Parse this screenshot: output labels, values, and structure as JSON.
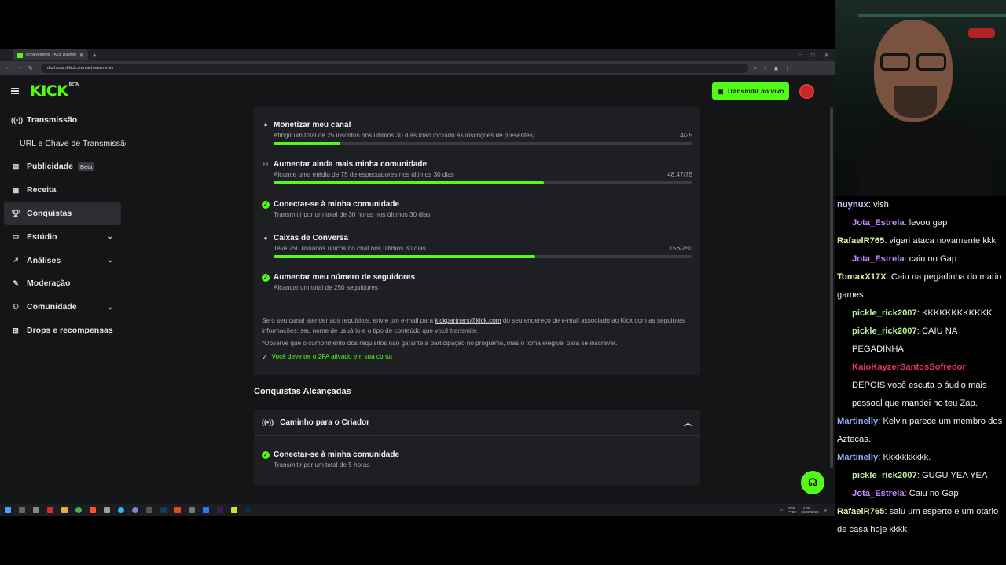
{
  "browser": {
    "tab_title": "Achievements - Kick Dashboard",
    "url": "dashboard.kick.com/achievements",
    "new_tab": "+"
  },
  "topnav": {
    "logo": "KICK",
    "logo_badge": "BETA",
    "live_button": "Transmitir ao vivo"
  },
  "sidebar": {
    "items": [
      {
        "label": "Transmissão",
        "icon": "broadcast-icon"
      },
      {
        "label": "URL e Chave de Transmissão",
        "icon": ""
      },
      {
        "label": "Publicidade",
        "icon": "ad-icon",
        "badge": "Beta"
      },
      {
        "label": "Receita",
        "icon": "revenue-icon"
      },
      {
        "label": "Conquistas",
        "icon": "trophy-icon"
      },
      {
        "label": "Estúdio",
        "icon": "studio-icon"
      },
      {
        "label": "Análises",
        "icon": "analytics-icon"
      },
      {
        "label": "Moderação",
        "icon": "moderation-icon"
      },
      {
        "label": "Comunidade",
        "icon": "community-icon"
      },
      {
        "label": "Drops e recompensas",
        "icon": "drops-icon"
      }
    ]
  },
  "requirements": [
    {
      "title": "Monetizar meu canal",
      "desc": "Atingir um total de 25 inscritos nos últimos 30 dias (não incluido as inscrições de presentes)",
      "progress_text": "4/25",
      "progress": 0.16
    },
    {
      "title": "Aumentar ainda mais minha comunidade",
      "desc": "Alcance uma média de 75 de espectadores nos últimos 30 dias",
      "progress_text": "48.47/75",
      "progress": 0.646
    },
    {
      "title": "Conectar-se à minha comunidade",
      "desc": "Transmitir por um total de 30 horas nos últimos 30 dias",
      "progress_text": "",
      "progress": null
    },
    {
      "title": "Caixas de Conversa",
      "desc": "Teve 250 usuários únicos no chat nos últimos 30 dias",
      "progress_text": "156/250",
      "progress": 0.624
    },
    {
      "title": "Aumentar meu número de seguidores",
      "desc": "Alcançar um total de 250 seguidores",
      "progress_text": "",
      "progress": null
    }
  ],
  "info": {
    "p1_a": "Se o seu canal atender aos requisitos, envie um e-mail para ",
    "p1_link": "kickpartners@kick.com",
    "p1_b": " do seu endereço de e-mail associado ao Kick com as seguintes informações: seu nome de usuário e o tipo de conteúdo que você transmite.",
    "p2": "*Observe que o cumprimento dos requisitos não garante a participação no programa, mas o torna elegível para se inscrever.",
    "check": "Você deve ter o 2FA ativado em sua conta"
  },
  "achieved": {
    "section_title": "Conquistas Alcançadas",
    "group_title": "Caminho para o Criador",
    "item_title": "Conectar-se à minha comunidade",
    "item_desc": "Transmitir por um total de 5 horas"
  },
  "taskbar": {
    "lang": "POR",
    "lang2": "PTB2",
    "time": "14:48",
    "date": "02/08/2026"
  },
  "chat": [
    {
      "user": "nuynux",
      "color": "#c9c4ff",
      "text": "vish",
      "indent": false
    },
    {
      "user": "Jota_Estrela",
      "color": "#c48cff",
      "text": "levou gap",
      "indent": true
    },
    {
      "user": "RafaelR765",
      "color": "#d8f5a2",
      "text": "vigari ataca novamente kkk",
      "indent": false
    },
    {
      "user": "Jota_Estrela",
      "color": "#c48cff",
      "text": "caiu no Gap",
      "indent": true
    },
    {
      "user": "TomaxX17X",
      "color": "#d8f5a2",
      "text": "Caiu na pegadinha do mario games",
      "indent": false
    },
    {
      "user": "pickle_rick2007",
      "color": "#b6f09c",
      "text": "KKKKKKKKKKKK",
      "indent": true
    },
    {
      "user": "pickle_rick2007",
      "color": "#b6f09c",
      "text": "CAIU NA PEGADINHA",
      "indent": true
    },
    {
      "user": "KaioKayzerSantosSofredor",
      "color": "#e8355a",
      "text": "DEPOIS você escuta o áudio mais pessoal que mandei no teu Zap.",
      "indent": true
    },
    {
      "user": "Martinelly",
      "color": "#8ab4f8",
      "text": "Kelvin parece um membro dos Aztecas.",
      "indent": false
    },
    {
      "user": "Martinelly",
      "color": "#8ab4f8",
      "text": "Kkkkkkkkkk.",
      "indent": false
    },
    {
      "user": "pickle_rick2007",
      "color": "#b6f09c",
      "text": "GUGU YEA YEA",
      "indent": true
    },
    {
      "user": "Jota_Estrela",
      "color": "#c48cff",
      "text": "Caiu no Gap",
      "indent": true
    },
    {
      "user": "RafaelR765",
      "color": "#d8f5a2",
      "text": "saiu um esperto e um otario de casa hoje kkkk",
      "indent": false
    }
  ]
}
